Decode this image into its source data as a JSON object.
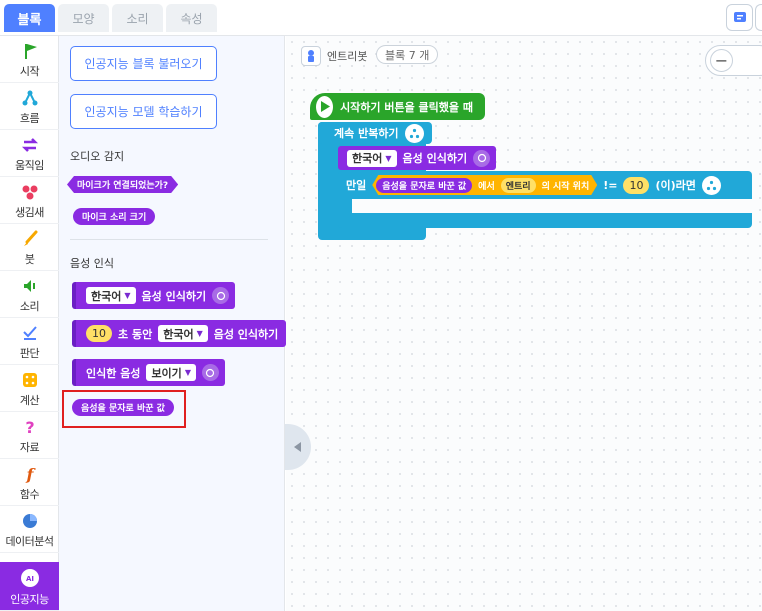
{
  "top_tabs": [
    {
      "label": "블록",
      "active": true
    },
    {
      "label": "모양",
      "active": false
    },
    {
      "label": "소리",
      "active": false
    },
    {
      "label": "속성",
      "active": false
    }
  ],
  "categories": [
    {
      "label": "시작",
      "icon": "flag-icon"
    },
    {
      "label": "흐름",
      "icon": "flow-icon"
    },
    {
      "label": "움직임",
      "icon": "move-arrows-icon"
    },
    {
      "label": "생김새",
      "icon": "looks-icon"
    },
    {
      "label": "붓",
      "icon": "brush-icon"
    },
    {
      "label": "소리",
      "icon": "speaker-icon"
    },
    {
      "label": "판단",
      "icon": "check-icon"
    },
    {
      "label": "계산",
      "icon": "calculator-icon"
    },
    {
      "label": "자료",
      "icon": "question-icon"
    },
    {
      "label": "함수",
      "icon": "function-icon"
    },
    {
      "label": "데이터분석",
      "icon": "pie-chart-icon"
    },
    {
      "label": "인공지능",
      "icon": "ai-icon",
      "active": true
    }
  ],
  "palette": {
    "load_button": "인공지능 블록 불러오기",
    "train_button": "인공지능 모델 학습하기",
    "section_audio": "오디오 감지",
    "block_mic_connected": "마이크가 연결되었는가?",
    "block_mic_volume": "마이크 소리 크기",
    "section_speech": "음성 인식",
    "block_recognize": {
      "lang": "한국어",
      "text": "음성 인식하기"
    },
    "block_recognize_for": {
      "seconds": "10",
      "mid": "초 동안",
      "lang": "한국어",
      "text": "음성 인식하기"
    },
    "block_show": {
      "text": "인식한 음성",
      "option": "보이기"
    },
    "block_text_value": "음성을 문자로 바꾼 값"
  },
  "workspace": {
    "project_name": "엔트리봇",
    "block_count": "블록 7 개",
    "zoom_out": "−",
    "script": {
      "hat": "시작하기 버튼을 클릭했을 때",
      "repeat": "계속 반복하기",
      "recognize": {
        "lang": "한국어",
        "text": "음성 인식하기"
      },
      "if_label": "만일",
      "cond_value": "음성을 문자로 바꾼 값",
      "cond_in": "에서",
      "cond_entry": "엔트리",
      "cond_pos": "의 시작 위치",
      "cond_op": "!=",
      "cond_num": "10",
      "cond_end": "(이)라면"
    }
  },
  "colors": {
    "accent": "#4f80ff",
    "ai_purple": "#8a2be2",
    "flow_blue": "#21a8d8",
    "start_green": "#2aa52a",
    "highlight": "#e02020"
  }
}
